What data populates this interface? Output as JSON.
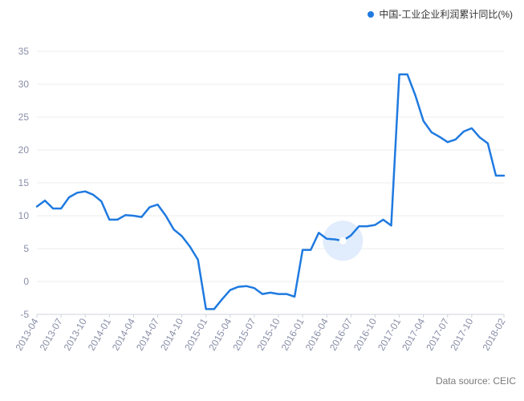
{
  "legend": {
    "label": "中国-工业企业利润累计同比(%)"
  },
  "source": "Data source: CEIC",
  "colors": {
    "series": "#1f7ae0",
    "grid": "#eeeeee",
    "tick": "#8a8fa8",
    "highlight": "#dce9fb"
  },
  "chart_data": {
    "type": "line",
    "title": "",
    "xlabel": "",
    "ylabel": "",
    "ylim": [
      -5,
      35
    ],
    "yticks": [
      -5,
      0,
      5,
      10,
      15,
      20,
      25,
      30,
      35
    ],
    "grid": true,
    "legend_position": "top-right",
    "x_tick_labels": [
      "2013-04",
      "2013-07",
      "2013-10",
      "2014-01",
      "2014-04",
      "2014-07",
      "2014-10",
      "2015-01",
      "2015-04",
      "2015-07",
      "2015-10",
      "2016-01",
      "2016-04",
      "2016-07",
      "2016-10",
      "2017-01",
      "2017-04",
      "2017-07",
      "2017-10",
      "2018-02"
    ],
    "highlight_point": "2016-06",
    "series": [
      {
        "name": "中国-工业企业利润累计同比(%)",
        "points": [
          {
            "x": "2013-04",
            "y": 11.4
          },
          {
            "x": "2013-05",
            "y": 12.3
          },
          {
            "x": "2013-06",
            "y": 11.1
          },
          {
            "x": "2013-07",
            "y": 11.1
          },
          {
            "x": "2013-08",
            "y": 12.8
          },
          {
            "x": "2013-09",
            "y": 13.5
          },
          {
            "x": "2013-10",
            "y": 13.7
          },
          {
            "x": "2013-11",
            "y": 13.2
          },
          {
            "x": "2013-12",
            "y": 12.2
          },
          {
            "x": "2014-01",
            "y": 9.4
          },
          {
            "x": "2014-02",
            "y": 9.4
          },
          {
            "x": "2014-03",
            "y": 10.1
          },
          {
            "x": "2014-04",
            "y": 10.0
          },
          {
            "x": "2014-05",
            "y": 9.8
          },
          {
            "x": "2014-06",
            "y": 11.3
          },
          {
            "x": "2014-07",
            "y": 11.7
          },
          {
            "x": "2014-08",
            "y": 10.0
          },
          {
            "x": "2014-09",
            "y": 7.9
          },
          {
            "x": "2014-10",
            "y": 6.9
          },
          {
            "x": "2014-11",
            "y": 5.3
          },
          {
            "x": "2014-12",
            "y": 3.3
          },
          {
            "x": "2015-01",
            "y": -4.2
          },
          {
            "x": "2015-02",
            "y": -4.2
          },
          {
            "x": "2015-03",
            "y": -2.7
          },
          {
            "x": "2015-04",
            "y": -1.3
          },
          {
            "x": "2015-05",
            "y": -0.8
          },
          {
            "x": "2015-06",
            "y": -0.7
          },
          {
            "x": "2015-07",
            "y": -1.0
          },
          {
            "x": "2015-08",
            "y": -1.9
          },
          {
            "x": "2015-09",
            "y": -1.7
          },
          {
            "x": "2015-10",
            "y": -1.9
          },
          {
            "x": "2015-11",
            "y": -1.9
          },
          {
            "x": "2015-12",
            "y": -2.3
          },
          {
            "x": "2016-01",
            "y": 4.8
          },
          {
            "x": "2016-02",
            "y": 4.8
          },
          {
            "x": "2016-03",
            "y": 7.4
          },
          {
            "x": "2016-04",
            "y": 6.5
          },
          {
            "x": "2016-05",
            "y": 6.4
          },
          {
            "x": "2016-06",
            "y": 6.2
          },
          {
            "x": "2016-07",
            "y": 7.0
          },
          {
            "x": "2016-08",
            "y": 8.4
          },
          {
            "x": "2016-09",
            "y": 8.4
          },
          {
            "x": "2016-10",
            "y": 8.6
          },
          {
            "x": "2016-11",
            "y": 9.4
          },
          {
            "x": "2016-12",
            "y": 8.5
          },
          {
            "x": "2017-01",
            "y": 31.5
          },
          {
            "x": "2017-02",
            "y": 31.5
          },
          {
            "x": "2017-03",
            "y": 28.3
          },
          {
            "x": "2017-04",
            "y": 24.4
          },
          {
            "x": "2017-05",
            "y": 22.7
          },
          {
            "x": "2017-06",
            "y": 22.0
          },
          {
            "x": "2017-07",
            "y": 21.2
          },
          {
            "x": "2017-08",
            "y": 21.6
          },
          {
            "x": "2017-09",
            "y": 22.8
          },
          {
            "x": "2017-10",
            "y": 23.3
          },
          {
            "x": "2017-11",
            "y": 21.9
          },
          {
            "x": "2017-12",
            "y": 21.0
          },
          {
            "x": "2018-01",
            "y": 16.1
          },
          {
            "x": "2018-02",
            "y": 16.1
          }
        ]
      }
    ]
  }
}
